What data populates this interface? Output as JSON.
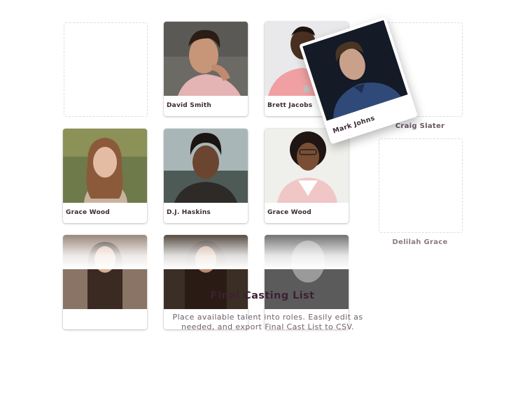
{
  "talent_cards": [
    {
      "name": "David Smith"
    },
    {
      "name": "Brett Jacobs"
    },
    {
      "name": "Grace Wood"
    },
    {
      "name": "D.J. Haskins"
    },
    {
      "name": "Grace Wood"
    }
  ],
  "dragging_card": {
    "name": "Mark Johns"
  },
  "roles": [
    {
      "label": "Craig Slater"
    },
    {
      "label": "Delilah Grace"
    }
  ],
  "section": {
    "title": "Final Casting List",
    "description": "Place available talent into roles. Easily edit as needed, and export Final Cast List to CSV."
  },
  "colors": {
    "accent": "#3b2233",
    "label": "#6b5564"
  }
}
